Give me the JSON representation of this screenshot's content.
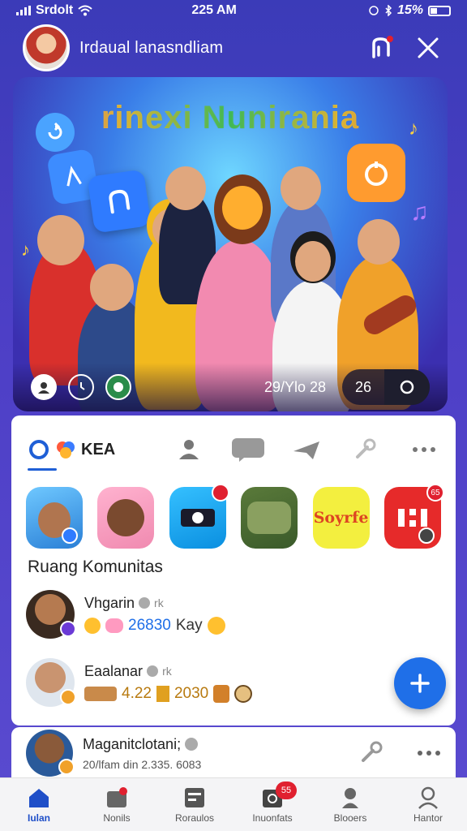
{
  "status_bar": {
    "carrier": "Srdolt",
    "time": "225 AM",
    "battery": "15%"
  },
  "header": {
    "title": "Irdaual lanasndliam"
  },
  "hero": {
    "title": "rinexi Nunirania",
    "time_label": "29/Ylo 28",
    "count_label": "26"
  },
  "tabs": {
    "main_label": "KEA"
  },
  "stories": [
    {
      "label": ""
    },
    {
      "label": ""
    },
    {
      "label": ""
    },
    {
      "label": ""
    },
    {
      "label": "Soyrfe"
    },
    {
      "label": ""
    }
  ],
  "story_badges": [
    "",
    "65"
  ],
  "section": {
    "title": "Ruang Komunitas"
  },
  "feed": [
    {
      "name": "Vhgarin",
      "suffix": "rk",
      "meta_value": "26830",
      "meta_text": "Kay"
    },
    {
      "name": "Eaalanar",
      "suffix": "rk",
      "meta_value": "4.22",
      "meta_text": "2030"
    }
  ],
  "card2": {
    "name": "Maganitclotani;",
    "meta": "20/lfam din 2.335. 6083"
  },
  "bottom_nav": [
    {
      "label": "Iulan",
      "active": true
    },
    {
      "label": "Nonils"
    },
    {
      "label": "Roraulos"
    },
    {
      "label": "Inuonfats",
      "badge": "55"
    },
    {
      "label": "Blooers"
    },
    {
      "label": "Hantor"
    }
  ],
  "colors": {
    "accent": "#1f6fe8",
    "badge": "#e0202f",
    "background": "#4d3fc6"
  }
}
